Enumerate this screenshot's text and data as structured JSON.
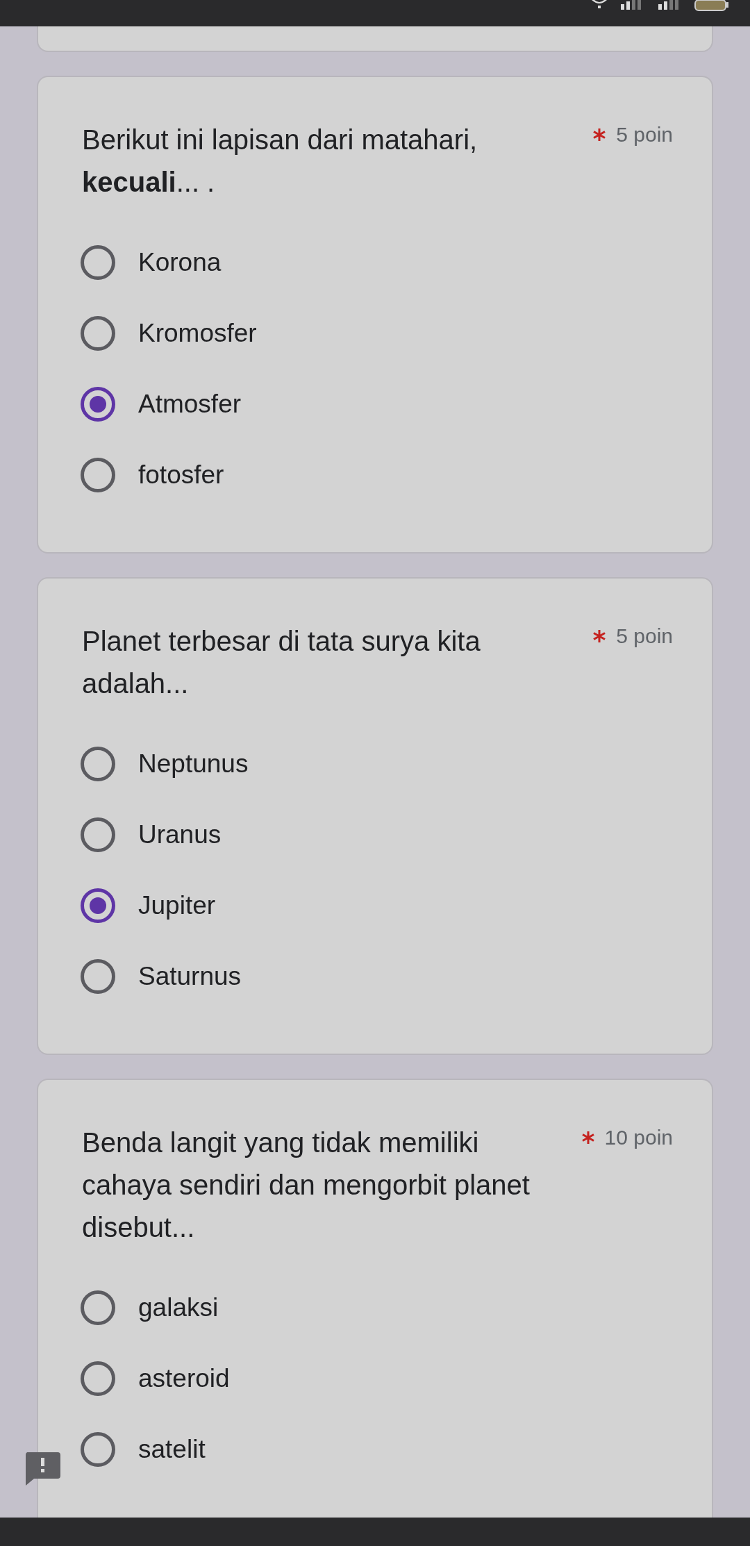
{
  "questions": [
    {
      "text": " Berikut ini lapisan dari matahari, **kecuali**... .",
      "required": true,
      "points": "5 poin",
      "options": [
        {
          "label": "Korona",
          "selected": false
        },
        {
          "label": "Kromosfer",
          "selected": false
        },
        {
          "label": "Atmosfer",
          "selected": true
        },
        {
          "label": "fotosfer",
          "selected": false
        }
      ]
    },
    {
      "text": "Planet terbesar di tata surya kita adalah...",
      "required": true,
      "points": "5 poin",
      "options": [
        {
          "label": "Neptunus",
          "selected": false
        },
        {
          "label": "Uranus",
          "selected": false
        },
        {
          "label": "Jupiter",
          "selected": true
        },
        {
          "label": "Saturnus",
          "selected": false
        }
      ]
    },
    {
      "text": "Benda langit yang tidak memiliki cahaya sendiri dan mengorbit planet disebut...",
      "required": true,
      "points": "10 poin",
      "options": [
        {
          "label": "galaksi",
          "selected": false
        },
        {
          "label": "asteroid",
          "selected": false
        },
        {
          "label": "satelit",
          "selected": false
        }
      ]
    }
  ]
}
